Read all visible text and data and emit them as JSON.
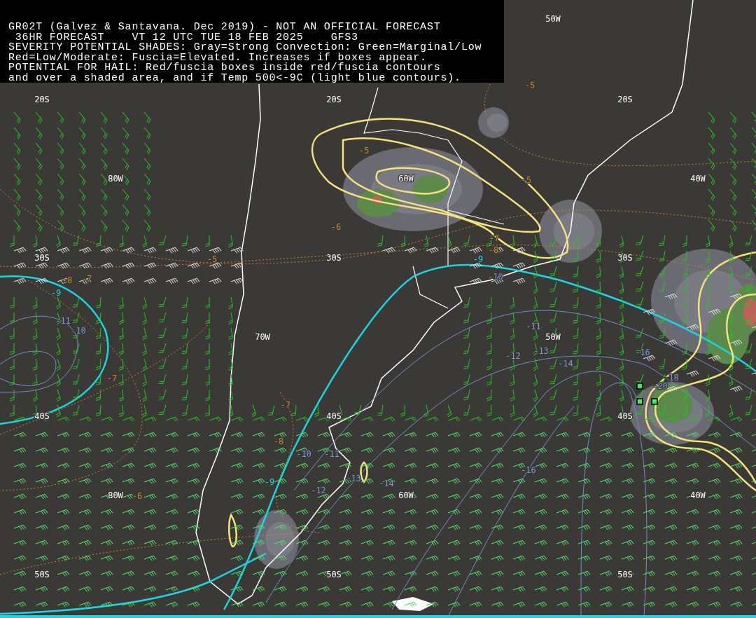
{
  "header": {
    "lines": [
      "GR02T (Galvez & Santavana. Dec 2019) - NOT AN OFFICIAL FORECAST",
      " 36HR FORECAST    VT 12 UTC TUE 18 FEB 2025    GFS3",
      "SEVERITY POTENTIAL SHADES: Gray=Strong Convection: Green=Marginal/Low",
      "Red=Low/Moderate: Fuscia=Elevated. Increases if boxes appear.",
      "POTENTIAL FOR HAIL: Red/fuscia boxes inside red/fuscia contours",
      "and over a shaded area, and if Temp 500<-9C (light blue contours)."
    ]
  },
  "map": {
    "latitude_labels": [
      "20S",
      "20S",
      "20S",
      "30S",
      "30S",
      "30S",
      "40S",
      "40S",
      "40S",
      "50S",
      "50S",
      "50S"
    ],
    "longitude_labels": [
      "50W",
      "80W",
      "60W",
      "40W",
      "70W",
      "50W",
      "80W",
      "60W",
      "40W"
    ],
    "contour_labels": [
      {
        "text": "-5",
        "kind": "temperature"
      },
      {
        "text": "-5",
        "kind": "temperature"
      },
      {
        "text": "-5",
        "kind": "temperature"
      },
      {
        "text": "-5",
        "kind": "temperature"
      },
      {
        "text": "-6",
        "kind": "temperature"
      },
      {
        "text": "-7",
        "kind": "temperature"
      },
      {
        "text": "-8",
        "kind": "temperature"
      },
      {
        "text": "-8",
        "kind": "temperature"
      },
      {
        "text": "-7",
        "kind": "temperature"
      },
      {
        "text": "-7",
        "kind": "temperature"
      },
      {
        "text": "-7",
        "kind": "temperature"
      },
      {
        "text": "-8",
        "kind": "temperature"
      },
      {
        "text": "-6",
        "kind": "temperature"
      },
      {
        "text": "-9",
        "kind": "threshold"
      },
      {
        "text": "-9",
        "kind": "threshold"
      },
      {
        "text": "-9",
        "kind": "threshold"
      },
      {
        "text": "-10",
        "kind": "cold"
      },
      {
        "text": "-11",
        "kind": "cold"
      },
      {
        "text": "-10",
        "kind": "cold"
      },
      {
        "text": "-11",
        "kind": "cold"
      },
      {
        "text": "-12",
        "kind": "cold"
      },
      {
        "text": "-13",
        "kind": "cold"
      },
      {
        "text": "-14",
        "kind": "cold"
      },
      {
        "text": "-16",
        "kind": "cold"
      },
      {
        "text": "-16",
        "kind": "cold"
      },
      {
        "text": "-10",
        "kind": "cold"
      },
      {
        "text": "-11",
        "kind": "cold"
      },
      {
        "text": "-12",
        "kind": "cold"
      },
      {
        "text": "-13",
        "kind": "cold"
      },
      {
        "text": "-14",
        "kind": "cold"
      },
      {
        "text": "-18",
        "kind": "cold"
      },
      {
        "text": "-20",
        "kind": "cold"
      }
    ]
  }
}
